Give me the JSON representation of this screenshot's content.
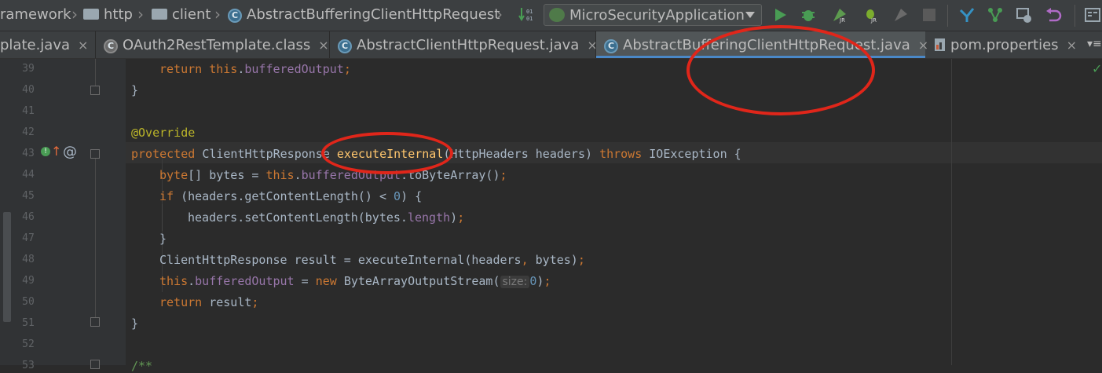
{
  "breadcrumb": {
    "items": [
      "ramework",
      "http",
      "client",
      "AbstractBufferingClientHttpRequest"
    ]
  },
  "run_config": {
    "label": "MicroSecurityApplication"
  },
  "tabs": [
    {
      "label": "plate.java"
    },
    {
      "label": "OAuth2RestTemplate.class"
    },
    {
      "label": "AbstractClientHttpRequest.java"
    },
    {
      "label": "AbstractBufferingClientHttpRequest.java",
      "active": true
    },
    {
      "label": "pom.properties"
    }
  ],
  "close_glyph": "×",
  "line_numbers": [
    "39",
    "40",
    "41",
    "42",
    "43",
    "44",
    "45",
    "46",
    "47",
    "48",
    "49",
    "50",
    "51",
    "52",
    "53"
  ],
  "code": {
    "l39a": "return ",
    "l39b": "this",
    "l39c": ".",
    "l39d": "bufferedOutput",
    "l39e": ";",
    "l40": "}",
    "l42": "@Override",
    "l43a": "protected ",
    "l43b": "ClientHttpResponse ",
    "l43c": "executeInternal",
    "l43d": "(HttpHeaders headers) ",
    "l43e": "throws ",
    "l43f": "IOException {",
    "l44a": "byte",
    "l44b": "[] bytes = ",
    "l44c": "this",
    "l44d": ".",
    "l44e": "bufferedOutput",
    "l44f": ".toByteArray()",
    "l44g": ";",
    "l45a": "if ",
    "l45b": "(headers.getContentLength() < ",
    "l45c": "0",
    "l45d": ") {",
    "l46a": "headers.setContentLength(bytes.",
    "l46b": "length",
    "l46c": ")",
    "l46d": ";",
    "l47": "}",
    "l48a": "ClientHttpResponse result = executeInternal(headers",
    "l48b": ", ",
    "l48c": "bytes)",
    "l48d": ";",
    "l49a": "this",
    "l49b": ".",
    "l49c": "bufferedOutput",
    "l49d": " = ",
    "l49e": "new ",
    "l49f": "ByteArrayOutputStream(",
    "l49hint": "size:",
    "l49g": "0",
    "l49h": ")",
    "l49i": ";",
    "l50a": "return ",
    "l50b": "result",
    "l50c": ";",
    "l51": "}",
    "l53": "/**"
  },
  "gutter": {
    "at_sign": "@"
  },
  "colors": {
    "annotation_oval": "#e0261a",
    "keyword": "#cc7832",
    "field": "#9876aa"
  }
}
